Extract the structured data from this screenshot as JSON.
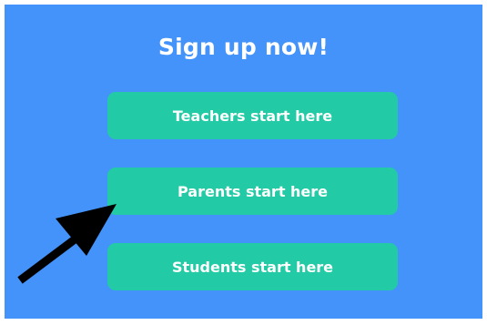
{
  "title": "Sign up now!",
  "buttons": {
    "teachers": "Teachers start here",
    "parents": "Parents start here",
    "students": "Students start here"
  },
  "icons": {
    "pointer": "arrow-icon"
  },
  "colors": {
    "background": "#4493fb",
    "button": "#22cba5",
    "text": "#ffffff",
    "arrow": "#000000"
  }
}
